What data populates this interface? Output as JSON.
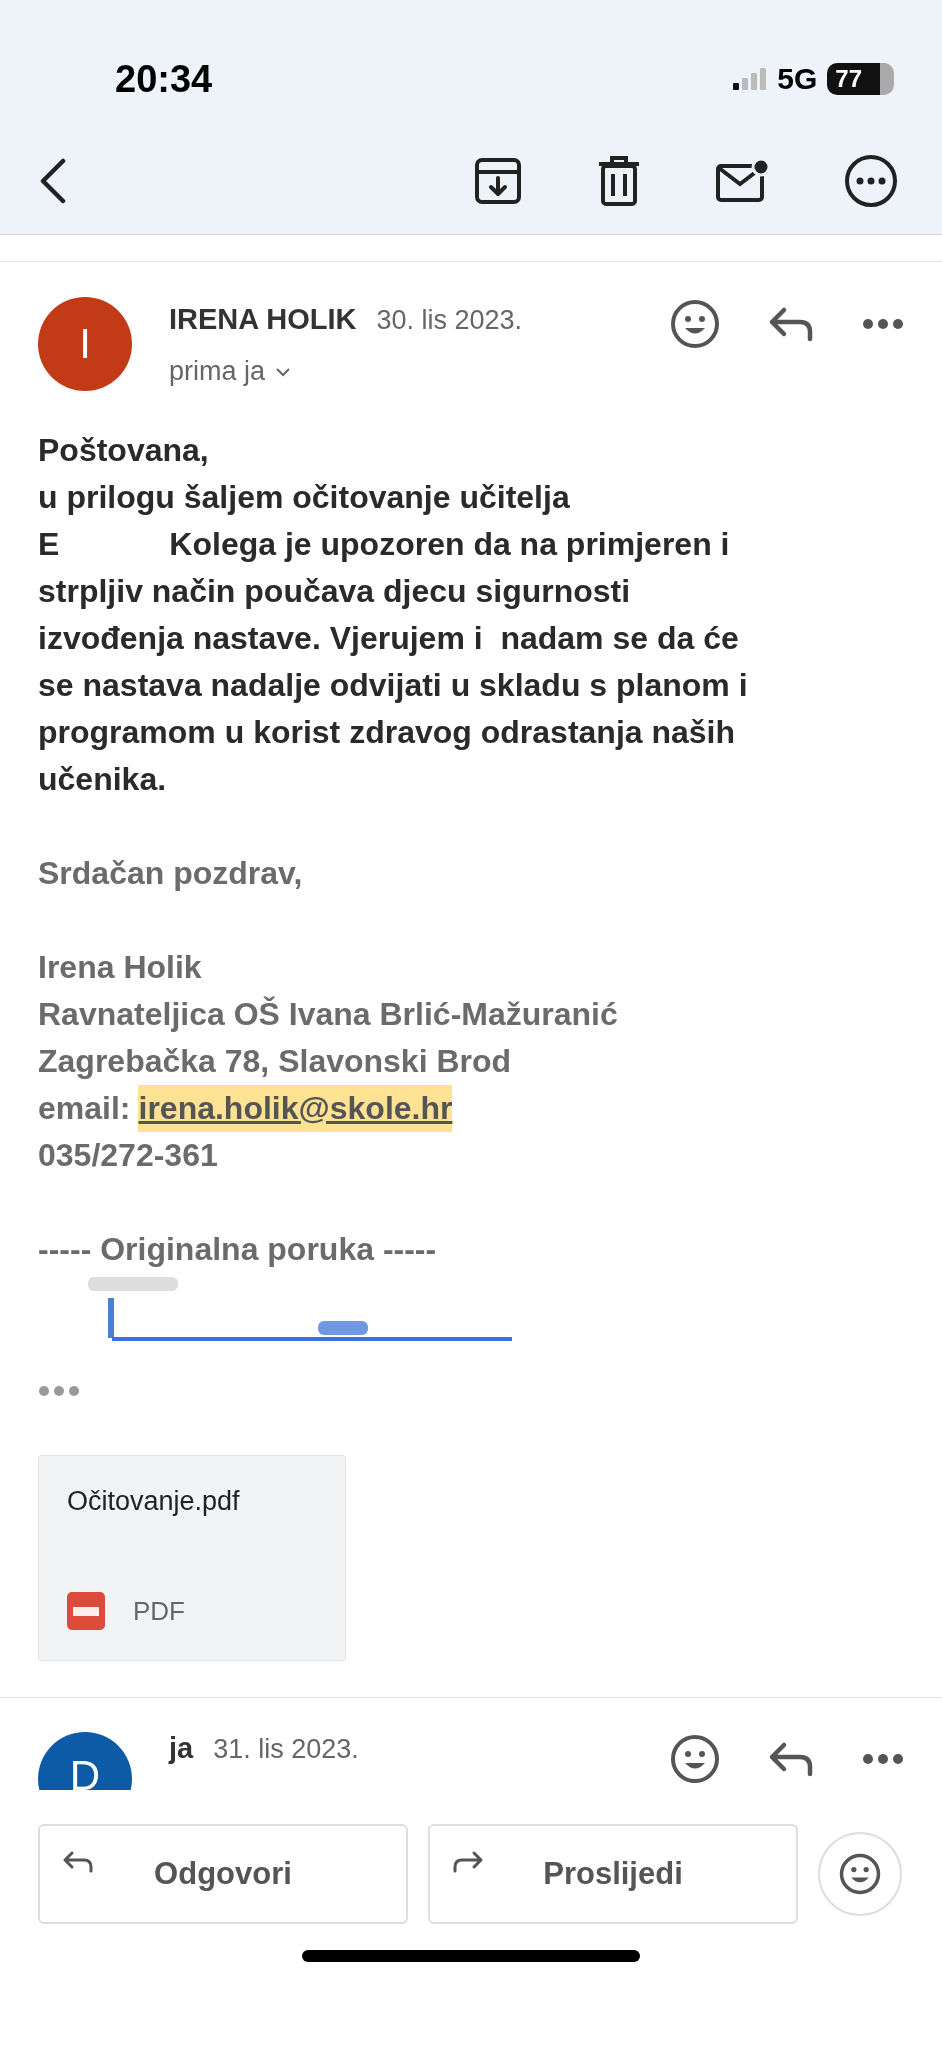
{
  "status_bar": {
    "time": "20:34",
    "network": "5G",
    "battery": "77"
  },
  "message": {
    "sender": "IRENA HOLIK",
    "avatar_letter": "I",
    "date": "30. lis 2023.",
    "recipient": "prima ja",
    "body": [
      {
        "parts": [
          "Poštovana,"
        ]
      },
      {
        "parts": [
          "u prilogu šaljem očitovanje učitelja"
        ]
      },
      {
        "parts": [
          "E",
          "Kolega je upozoren da na primjeren i"
        ]
      },
      {
        "parts": [
          "strpljiv način poučava djecu sigurnosti"
        ]
      },
      {
        "parts": [
          "izvođenja nastave. Vjerujem i  nadam se da će"
        ]
      },
      {
        "parts": [
          "se nastava nadalje odvijati u skladu s planom i"
        ]
      },
      {
        "parts": [
          "programom u korist zdravog odrastanja naših"
        ]
      },
      {
        "parts": [
          "učenika."
        ]
      }
    ],
    "greeting": "Srdačan pozdrav,",
    "signature": [
      "Irena Holik",
      "Ravnateljica OŠ Ivana Brlić-Mažuranić",
      "Zagrebačka 78, Slavonski Brod"
    ],
    "email_label": "email:",
    "email": "irena.holik@skole.hr",
    "phone": "035/272-361",
    "quoted_header": "----- Originalna poruka -----",
    "attachment": {
      "name": "Očitovanje.pdf",
      "type": "PDF"
    }
  },
  "next_message": {
    "sender": "ja",
    "avatar_letter": "D",
    "date": "31. lis 2023."
  },
  "actions": [
    {
      "kind": "reply",
      "label": "Odgovori"
    },
    {
      "kind": "forward",
      "label": "Proslijedi"
    }
  ]
}
